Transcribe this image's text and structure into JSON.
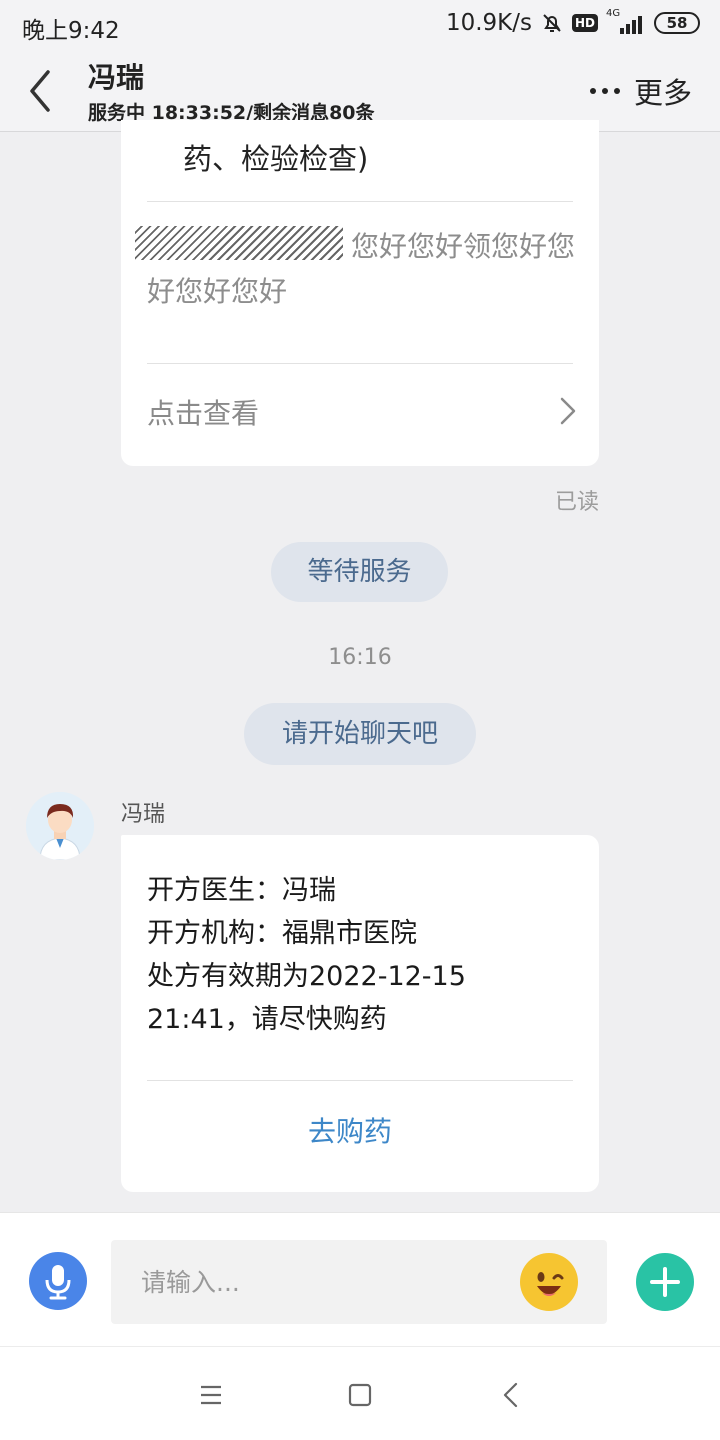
{
  "status_bar": {
    "time": "晚上9:42",
    "network_speed": "10.9K/s",
    "hd": "HD",
    "signal_label": "4G",
    "battery": "58"
  },
  "header": {
    "title": "冯瑞",
    "subtitle": "服务中 18:33:52/剩余消息80条",
    "more_label": "更多"
  },
  "prev_card": {
    "top_text": "药、检验检查)",
    "message": "您好您好领您好您好您好您好",
    "view_label": "点击查看"
  },
  "read_label": "已读",
  "system_pill_1": "等待服务",
  "timestamp": "16:16",
  "system_pill_2": "请开始聊天吧",
  "doctor_message": {
    "sender": "冯瑞",
    "lines": [
      "开方医生：冯瑞",
      "开方机构：福鼎市医院",
      "处方有效期为2022-12-15",
      "21:41，请尽快购药"
    ],
    "action_label": "去购药"
  },
  "input": {
    "placeholder": "请输入..."
  },
  "colors": {
    "accent_blue": "#3d87c8",
    "mic_blue": "#4a85e8",
    "plus_teal": "#29c3a5",
    "pill_bg": "#dfe4ec",
    "pill_text": "#4b6a8e"
  },
  "icons": [
    "back-arrow-icon",
    "more-dots-icon",
    "chevron-right-icon",
    "doctor-avatar",
    "mic-icon",
    "emoji-icon",
    "plus-icon",
    "menu-icon",
    "home-icon",
    "back-nav-icon"
  ]
}
